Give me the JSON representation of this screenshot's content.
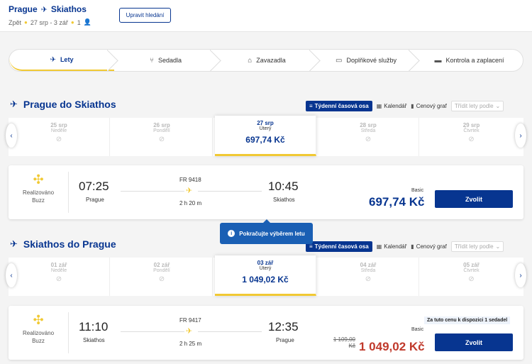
{
  "header": {
    "origin": "Prague",
    "destination": "Skiathos",
    "trip_type": "Zpět",
    "dates": "27 srp - 3 zář",
    "passengers": "1",
    "edit_label": "Upravit hledání"
  },
  "steps": [
    {
      "label": "Lety",
      "icon": "plane-icon"
    },
    {
      "label": "Sedadla",
      "icon": "seat-icon"
    },
    {
      "label": "Zavazadla",
      "icon": "luggage-icon"
    },
    {
      "label": "Doplňkové služby",
      "icon": "services-icon"
    },
    {
      "label": "Kontrola a zaplacení",
      "icon": "card-icon"
    }
  ],
  "outbound": {
    "title": "Prague do Skiathos",
    "controls": {
      "weekly": "Týdenní časová osa",
      "calendar": "Kalendář",
      "price_graph": "Cenový graf",
      "sort": "Třídit lety podle"
    },
    "days": [
      {
        "date": "25 srp",
        "weekday": "Neděle"
      },
      {
        "date": "26 srp",
        "weekday": "Pondělí"
      },
      {
        "date": "27 srp",
        "weekday": "Úterý",
        "price": "697,74 Kč"
      },
      {
        "date": "28 srp",
        "weekday": "Středa"
      },
      {
        "date": "29 srp",
        "weekday": "Čtvrtek"
      }
    ],
    "flight": {
      "operator_line1": "Realizováno",
      "operator_line2": "Buzz",
      "depart_time": "07:25",
      "depart_city": "Prague",
      "flight_no": "FR 9418",
      "duration": "2 h 20 m",
      "arrive_time": "10:45",
      "arrive_city": "Skiathos",
      "fare": "Basic",
      "price": "697,74 Kč",
      "select_label": "Zvolit"
    }
  },
  "tooltip": "Pokračujte výběrem letu",
  "inbound": {
    "title": "Skiathos do Prague",
    "controls": {
      "weekly": "Týdenní časová osa",
      "calendar": "Kalendář",
      "price_graph": "Cenový graf",
      "sort": "Třídit lety podle"
    },
    "days": [
      {
        "date": "01 zář",
        "weekday": "Neděle"
      },
      {
        "date": "02 zář",
        "weekday": "Pondělí"
      },
      {
        "date": "03 zář",
        "weekday": "Úterý",
        "price": "1 049,02 Kč"
      },
      {
        "date": "04 zář",
        "weekday": "Středa"
      },
      {
        "date": "05 zář",
        "weekday": "Čtvrtek"
      }
    ],
    "flight": {
      "operator_line1": "Realizováno",
      "operator_line2": "Buzz",
      "depart_time": "11:10",
      "depart_city": "Skiathos",
      "flight_no": "FR 9417",
      "duration": "2 h 25 m",
      "arrive_time": "12:35",
      "arrive_city": "Prague",
      "availability": "Za tuto cenu k dispozici 1 sedadel",
      "fare": "Basic",
      "old_price_line1": "1 109,00",
      "old_price_line2": "Kč",
      "price": "1 049,02 Kč",
      "select_label": "Zvolit"
    }
  },
  "colors": {
    "brand": "#073590",
    "accent": "#f1c933",
    "sale": "#c0392b",
    "tooltip": "#1a5fb4"
  }
}
